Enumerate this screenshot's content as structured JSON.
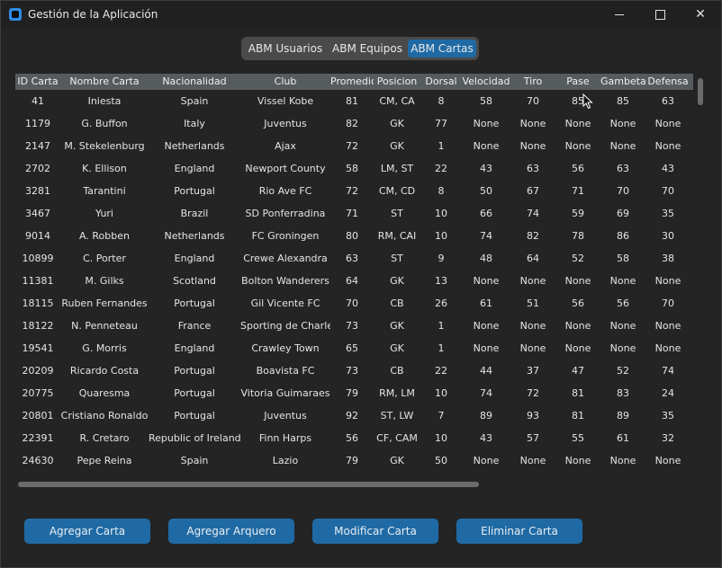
{
  "window": {
    "title": "Gestión de la Aplicación",
    "minimize": "minimize",
    "maximize": "maximize",
    "close": "✕"
  },
  "tabs": [
    {
      "label": "ABM Usuarios",
      "active": false
    },
    {
      "label": "ABM Equipos",
      "active": false
    },
    {
      "label": "ABM Cartas",
      "active": true
    }
  ],
  "table": {
    "columns": [
      "ID Carta",
      "Nombre Carta",
      "Nacionalidad",
      "Club",
      "Promedio",
      "Posicion",
      "Dorsal",
      "Velocidad",
      "Tiro",
      "Pase",
      "Gambeta",
      "Defensa"
    ],
    "rows": [
      [
        "41",
        "Iniesta",
        "Spain",
        "Vissel Kobe",
        "81",
        "CM, CA",
        "8",
        "58",
        "70",
        "85",
        "85",
        "63"
      ],
      [
        "1179",
        "G. Buffon",
        "Italy",
        "Juventus",
        "82",
        "GK",
        "77",
        "None",
        "None",
        "None",
        "None",
        "None"
      ],
      [
        "2147",
        "M. Stekelenburg",
        "Netherlands",
        "Ajax",
        "72",
        "GK",
        "1",
        "None",
        "None",
        "None",
        "None",
        "None"
      ],
      [
        "2702",
        "K. Ellison",
        "England",
        "Newport County",
        "58",
        "LM, ST",
        "22",
        "43",
        "63",
        "56",
        "63",
        "43"
      ],
      [
        "3281",
        "Tarantini",
        "Portugal",
        "Rio Ave FC",
        "72",
        "CM, CD",
        "8",
        "50",
        "67",
        "71",
        "70",
        "70"
      ],
      [
        "3467",
        "Yuri",
        "Brazil",
        "SD Ponferradina",
        "71",
        "ST",
        "10",
        "66",
        "74",
        "59",
        "69",
        "35"
      ],
      [
        "9014",
        "A. Robben",
        "Netherlands",
        "FC Groningen",
        "80",
        "RM, CAI",
        "10",
        "74",
        "82",
        "78",
        "86",
        "30"
      ],
      [
        "10899",
        "C. Porter",
        "England",
        "Crewe Alexandra",
        "63",
        "ST",
        "9",
        "48",
        "64",
        "52",
        "58",
        "38"
      ],
      [
        "11381",
        "M. Gilks",
        "Scotland",
        "Bolton Wanderers",
        "64",
        "GK",
        "13",
        "None",
        "None",
        "None",
        "None",
        "None"
      ],
      [
        "18115",
        "Ruben Fernandes",
        "Portugal",
        "Gil Vicente FC",
        "70",
        "CB",
        "26",
        "61",
        "51",
        "56",
        "56",
        "70"
      ],
      [
        "18122",
        "N. Penneteau",
        "France",
        "Sporting de Charleroi",
        "73",
        "GK",
        "1",
        "None",
        "None",
        "None",
        "None",
        "None"
      ],
      [
        "19541",
        "G. Morris",
        "England",
        "Crawley Town",
        "65",
        "GK",
        "1",
        "None",
        "None",
        "None",
        "None",
        "None"
      ],
      [
        "20209",
        "Ricardo Costa",
        "Portugal",
        "Boavista FC",
        "73",
        "CB",
        "22",
        "44",
        "37",
        "47",
        "52",
        "74"
      ],
      [
        "20775",
        "Quaresma",
        "Portugal",
        "Vitoria Guimaraes",
        "79",
        "RM, LM",
        "10",
        "74",
        "72",
        "81",
        "83",
        "24"
      ],
      [
        "20801",
        "Cristiano Ronaldo",
        "Portugal",
        "Juventus",
        "92",
        "ST, LW",
        "7",
        "89",
        "93",
        "81",
        "89",
        "35"
      ],
      [
        "22391",
        "R. Cretaro",
        "Republic of Ireland",
        "Finn Harps",
        "56",
        "CF, CAM",
        "10",
        "43",
        "57",
        "55",
        "61",
        "32"
      ],
      [
        "24630",
        "Pepe Reina",
        "Spain",
        "Lazio",
        "79",
        "GK",
        "50",
        "None",
        "None",
        "None",
        "None",
        "None"
      ]
    ]
  },
  "actions": {
    "add_card": "Agregar Carta",
    "add_goalkeeper": "Agregar Arquero",
    "edit_card": "Modificar Carta",
    "delete_card": "Eliminar Carta"
  },
  "colors": {
    "accent": "#1f6aa5",
    "header_bg": "#565b5e",
    "window_bg": "#242424"
  },
  "icons": {
    "app": "app-icon",
    "cursor": "mouse-pointer-icon"
  }
}
